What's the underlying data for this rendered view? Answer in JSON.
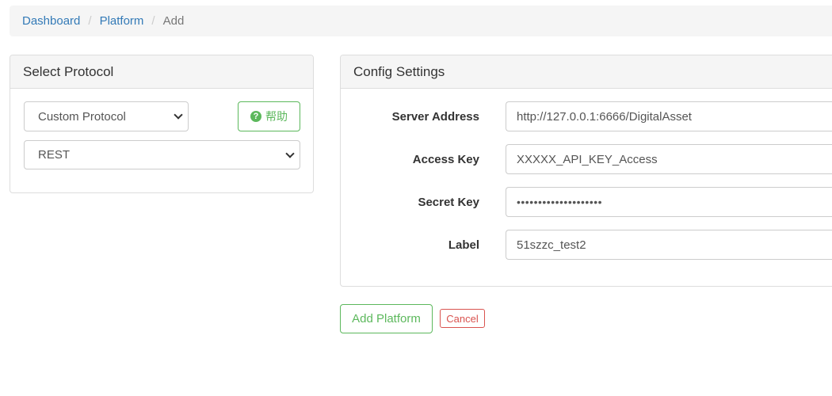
{
  "breadcrumb": {
    "items": [
      "Dashboard",
      "Platform"
    ],
    "separator": "/",
    "active": "Add"
  },
  "protocol_panel": {
    "title": "Select Protocol",
    "protocol_select": {
      "selected": "Custom Protocol",
      "icon": "chevron-down-icon"
    },
    "type_select": {
      "selected": "REST",
      "icon": "chevron-down-icon"
    },
    "help_button": {
      "label": "帮助",
      "icon": "question-circle-icon"
    }
  },
  "config_panel": {
    "title": "Config Settings",
    "fields": {
      "server_address": {
        "label": "Server Address",
        "value": "http://127.0.0.1:6666/DigitalAsset"
      },
      "access_key": {
        "label": "Access Key",
        "value": "XXXXX_API_KEY_Access"
      },
      "secret_key": {
        "label": "Secret Key",
        "value": "••••••••••••••••••••"
      },
      "label": {
        "label": "Label",
        "value": "51szzc_test2"
      }
    }
  },
  "actions": {
    "add_label": "Add Platform",
    "cancel_label": "Cancel"
  },
  "colors": {
    "link": "#337ab7",
    "success": "#5cb85c",
    "danger": "#d9534f"
  }
}
